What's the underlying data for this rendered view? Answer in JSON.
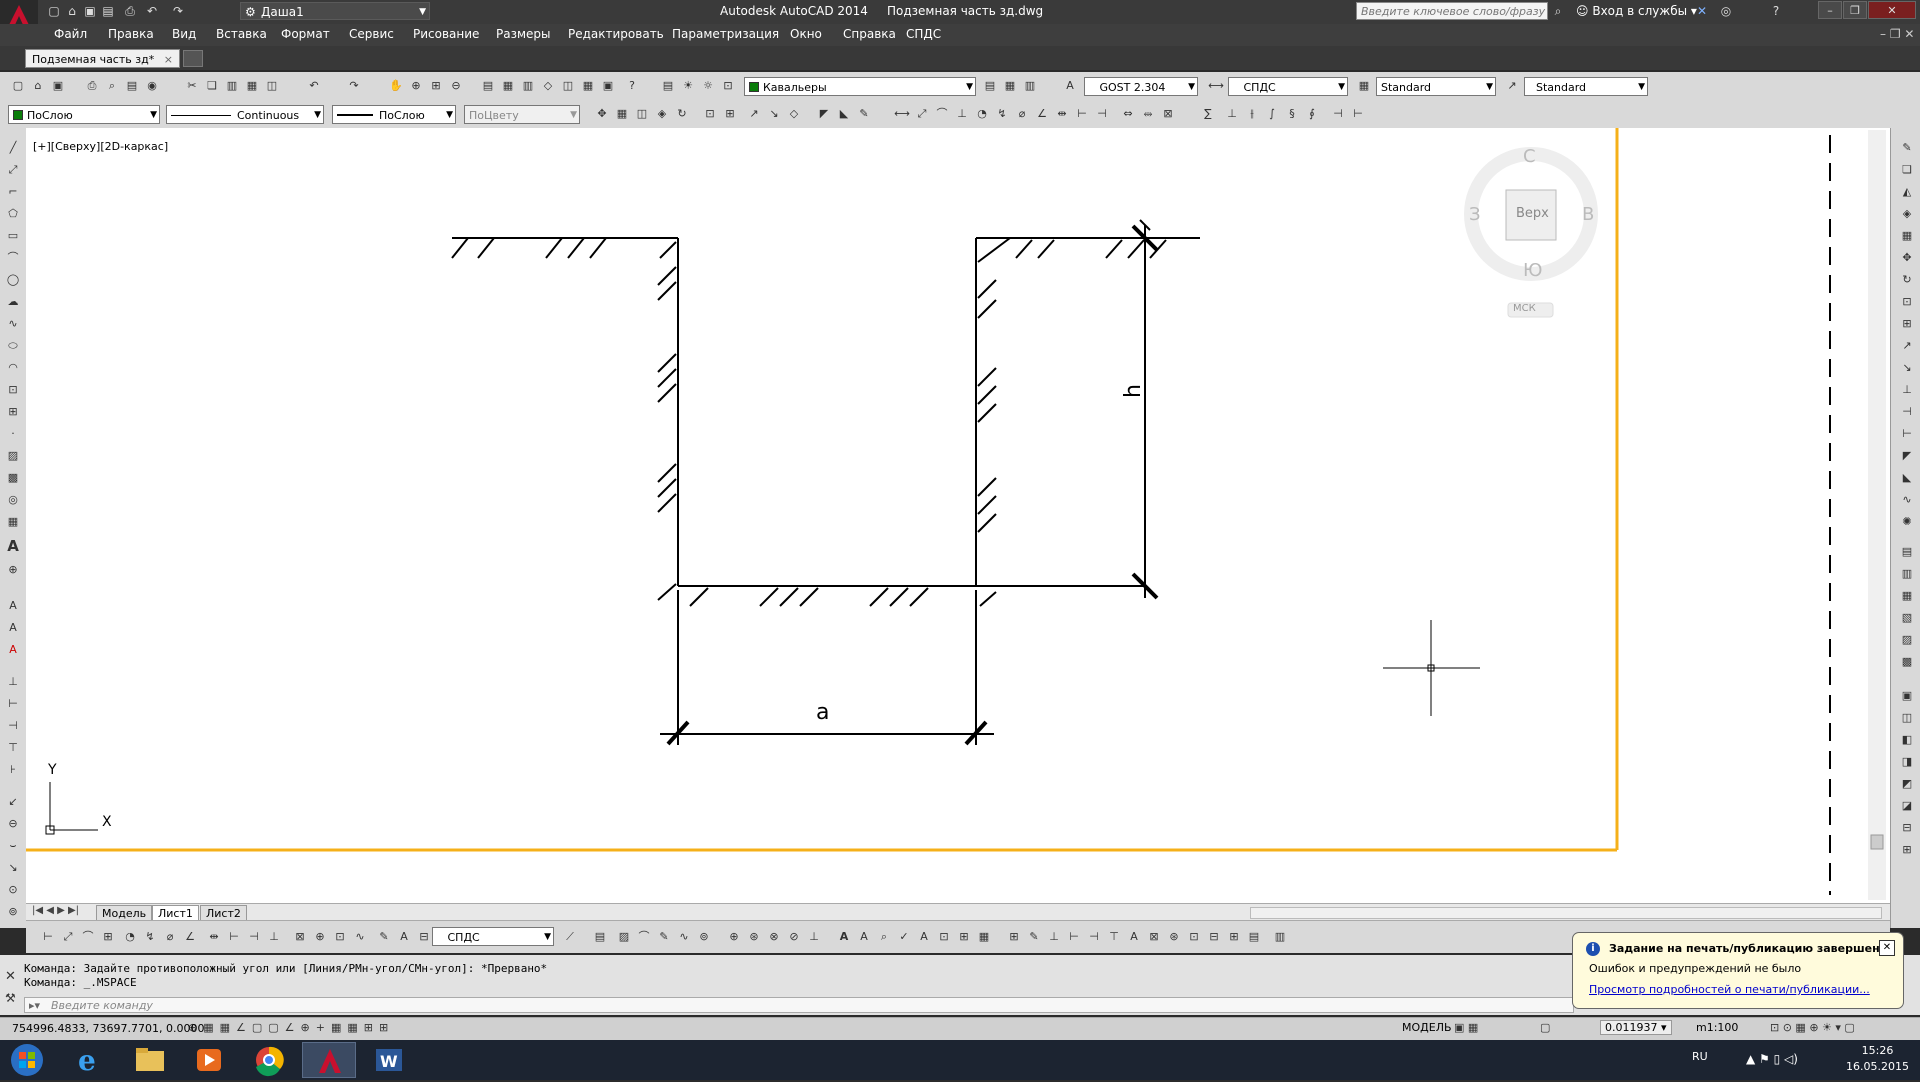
{
  "title_bar": {
    "app_title": "Autodesk AutoCAD 2014",
    "file_title": "Подземная часть зд.dwg",
    "workspace": "Даша1",
    "search_placeholder": "Введите ключевое слово/фразу",
    "signin": "Вход в службы"
  },
  "menu": [
    "Файл",
    "Правка",
    "Вид",
    "Вставка",
    "Формат",
    "Сервис",
    "Рисование",
    "Размеры",
    "Редактировать",
    "Параметризация",
    "Окно",
    "Справка",
    "СПДС"
  ],
  "doc_tab": {
    "label": "Подземная часть зд*",
    "close": "×"
  },
  "toolbar1": {
    "layer": "Кавальеры",
    "text_style": "GOST 2.304",
    "dim_style": "СПДС",
    "table_style": "Standard",
    "mleader_style": "Standard"
  },
  "toolbar2": {
    "color": "ПоСлою",
    "linetype": "Continuous",
    "lineweight": "ПоСлою",
    "plotstyle": "ПоЦвету"
  },
  "viewport": {
    "label": "[+][Сверху][2D-каркас]",
    "dim_a": "a",
    "dim_h": "h",
    "ucs_x": "X",
    "ucs_y": "Y"
  },
  "viewcube": {
    "north": "С",
    "south": "Ю",
    "west": "З",
    "east": "В",
    "face": "Верх",
    "ucs": "МСК"
  },
  "layout_tabs": [
    "Модель",
    "Лист1",
    "Лист2"
  ],
  "bottom_toolbar": {
    "dim_style": "СПДС"
  },
  "command": {
    "line1": "Команда: Задайте противоположный угол или [Линия/РМн-угол/СМн-угол]: *Прервано*",
    "line2": "Команда: _.MSPACE",
    "input_placeholder": "Введите команду"
  },
  "status": {
    "coords": "754996.4833, 73697.7701, 0.0000",
    "model": "МОДЕЛЬ",
    "scale_value": "0.011937",
    "annot_scale": "m1:100"
  },
  "balloon": {
    "title": "Задание на печать/публикацию завершено",
    "message": "Ошибок и предупреждений не было",
    "link": "Просмотр подробностей о печати/публикации..."
  },
  "taskbar": {
    "lang": "RU",
    "time": "15:26",
    "date": "16.05.2015"
  }
}
